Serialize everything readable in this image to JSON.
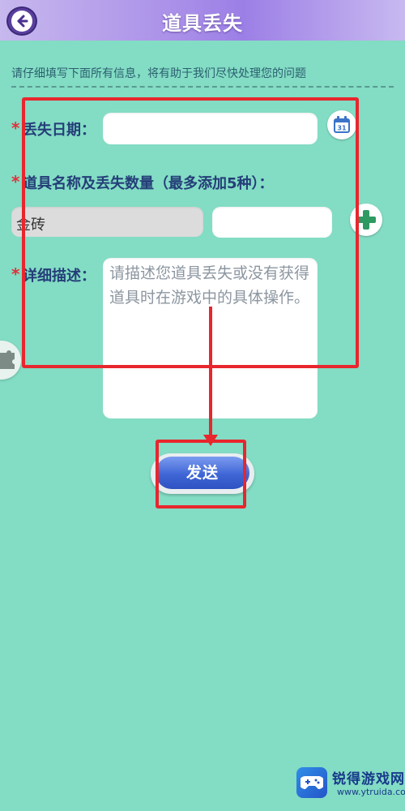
{
  "header": {
    "title": "道具丢失",
    "back_icon": "back-arrow-icon",
    "background": "#a98ee8"
  },
  "notice": "请仔细填写下面所有信息，将有助于我们尽快处理您的问题",
  "form": {
    "required_mark": "*",
    "date_label": "丢失日期：",
    "date_value": "",
    "calendar_icon": "calendar-icon",
    "calendar_day": "31",
    "item_label": "道具名称及丢失数量（最多添加5种）：",
    "item_name_value": "金砖",
    "item_quantity_value": "",
    "add_icon": "plus-icon",
    "desc_label": "详细描述：",
    "desc_placeholder": "请描述您道具丢失或没有获得道具时在游戏中的具体操作。"
  },
  "send_button": "发送",
  "watermark": {
    "brand": "锐得游戏网",
    "url": "www.ytruida.com"
  },
  "colors": {
    "background": "#83dcc4",
    "label": "#243e78",
    "required": "#e0313a",
    "annotation": "#e8262d",
    "send_button": "#3f66d6"
  }
}
